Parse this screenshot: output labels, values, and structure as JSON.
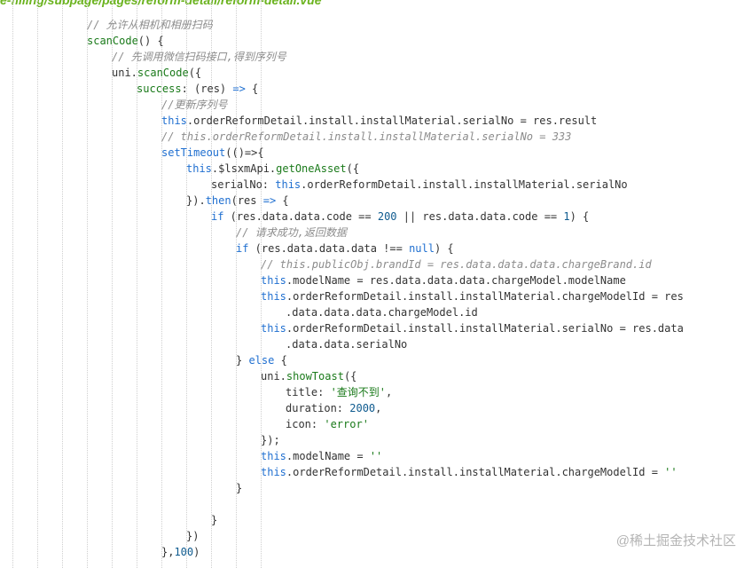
{
  "file_path": "e-filling/subpage/pages/reform-detail/reform-detail.vue",
  "watermark": "@稀土掘金技术社区",
  "colors": {
    "comment": "#8c8c8c",
    "keyword": "#1f6fd0",
    "function": "#1a7a1a",
    "number": "#0f5b8f",
    "string": "#1a7a1a",
    "plain": "#333333",
    "path": "#6bb31f"
  },
  "code_lines": [
    {
      "indent": 3,
      "tokens": [
        {
          "t": "// 允许从相机和相册扫码",
          "c": "cm"
        }
      ]
    },
    {
      "indent": 3,
      "tokens": [
        {
          "t": "scanCode",
          "c": "fn"
        },
        {
          "t": "() {",
          "c": "plain"
        }
      ]
    },
    {
      "indent": 4,
      "tokens": [
        {
          "t": "// 先调用微信扫码接口,得到序列号",
          "c": "cm"
        }
      ]
    },
    {
      "indent": 4,
      "tokens": [
        {
          "t": "uni.",
          "c": "plain"
        },
        {
          "t": "scanCode",
          "c": "fn"
        },
        {
          "t": "({",
          "c": "plain"
        }
      ]
    },
    {
      "indent": 5,
      "tokens": [
        {
          "t": "success",
          "c": "fn"
        },
        {
          "t": ": (res) ",
          "c": "plain"
        },
        {
          "t": "=>",
          "c": "kw"
        },
        {
          "t": " {",
          "c": "plain"
        }
      ]
    },
    {
      "indent": 6,
      "tokens": [
        {
          "t": "//更新序列号",
          "c": "cm"
        }
      ]
    },
    {
      "indent": 6,
      "tokens": [
        {
          "t": "this",
          "c": "kw"
        },
        {
          "t": ".orderReformDetail.install.installMaterial.serialNo = res.result",
          "c": "plain"
        }
      ]
    },
    {
      "indent": 6,
      "tokens": [
        {
          "t": "// this.orderReformDetail.install.installMaterial.serialNo = 333",
          "c": "cm"
        }
      ]
    },
    {
      "indent": 6,
      "tokens": [
        {
          "t": "setTimeout",
          "c": "kw"
        },
        {
          "t": "(()=>{",
          "c": "plain"
        }
      ]
    },
    {
      "indent": 7,
      "tokens": [
        {
          "t": "this",
          "c": "kw"
        },
        {
          "t": ".$lsxmApi.",
          "c": "plain"
        },
        {
          "t": "getOneAsset",
          "c": "fn"
        },
        {
          "t": "({",
          "c": "plain"
        }
      ]
    },
    {
      "indent": 8,
      "tokens": [
        {
          "t": "serialNo: ",
          "c": "plain"
        },
        {
          "t": "this",
          "c": "kw"
        },
        {
          "t": ".orderReformDetail.install.installMaterial.serialNo",
          "c": "plain"
        }
      ]
    },
    {
      "indent": 7,
      "tokens": [
        {
          "t": "}).",
          "c": "plain"
        },
        {
          "t": "then",
          "c": "kw"
        },
        {
          "t": "(res ",
          "c": "plain"
        },
        {
          "t": "=>",
          "c": "kw"
        },
        {
          "t": " {",
          "c": "plain"
        }
      ]
    },
    {
      "indent": 8,
      "tokens": [
        {
          "t": "if",
          "c": "kw"
        },
        {
          "t": " (res.data.data.code == ",
          "c": "plain"
        },
        {
          "t": "200",
          "c": "num"
        },
        {
          "t": " || res.data.data.code == ",
          "c": "plain"
        },
        {
          "t": "1",
          "c": "num"
        },
        {
          "t": ") {",
          "c": "plain"
        }
      ]
    },
    {
      "indent": 9,
      "tokens": [
        {
          "t": "// 请求成功,返回数据",
          "c": "cm"
        }
      ]
    },
    {
      "indent": 9,
      "tokens": [
        {
          "t": "if",
          "c": "kw"
        },
        {
          "t": " (res.data.data.data !== ",
          "c": "plain"
        },
        {
          "t": "null",
          "c": "kw"
        },
        {
          "t": ") {",
          "c": "plain"
        }
      ]
    },
    {
      "indent": 10,
      "tokens": [
        {
          "t": "// this.publicObj.brandId = res.data.data.data.chargeBrand.id",
          "c": "cm"
        }
      ]
    },
    {
      "indent": 10,
      "tokens": [
        {
          "t": "this",
          "c": "kw"
        },
        {
          "t": ".modelName = res.data.data.data.chargeModel.modelName",
          "c": "plain"
        }
      ]
    },
    {
      "indent": 10,
      "tokens": [
        {
          "t": "this",
          "c": "kw"
        },
        {
          "t": ".orderReformDetail.install.installMaterial.chargeModelId = res",
          "c": "plain"
        }
      ]
    },
    {
      "indent": 11,
      "tokens": [
        {
          "t": ".data.data.data.chargeModel.id",
          "c": "plain"
        }
      ]
    },
    {
      "indent": 10,
      "tokens": [
        {
          "t": "this",
          "c": "kw"
        },
        {
          "t": ".orderReformDetail.install.installMaterial.serialNo = res.data",
          "c": "plain"
        }
      ]
    },
    {
      "indent": 11,
      "tokens": [
        {
          "t": ".data.data.serialNo",
          "c": "plain"
        }
      ]
    },
    {
      "indent": 9,
      "tokens": [
        {
          "t": "} ",
          "c": "plain"
        },
        {
          "t": "else",
          "c": "kw"
        },
        {
          "t": " {",
          "c": "plain"
        }
      ]
    },
    {
      "indent": 10,
      "tokens": [
        {
          "t": "uni.",
          "c": "plain"
        },
        {
          "t": "showToast",
          "c": "fn"
        },
        {
          "t": "({",
          "c": "plain"
        }
      ]
    },
    {
      "indent": 11,
      "tokens": [
        {
          "t": "title: ",
          "c": "plain"
        },
        {
          "t": "'查询不到'",
          "c": "str"
        },
        {
          "t": ",",
          "c": "plain"
        }
      ]
    },
    {
      "indent": 11,
      "tokens": [
        {
          "t": "duration: ",
          "c": "plain"
        },
        {
          "t": "2000",
          "c": "num"
        },
        {
          "t": ",",
          "c": "plain"
        }
      ]
    },
    {
      "indent": 11,
      "tokens": [
        {
          "t": "icon: ",
          "c": "plain"
        },
        {
          "t": "'error'",
          "c": "str"
        }
      ]
    },
    {
      "indent": 10,
      "tokens": [
        {
          "t": "});",
          "c": "plain"
        }
      ]
    },
    {
      "indent": 10,
      "tokens": [
        {
          "t": "this",
          "c": "kw"
        },
        {
          "t": ".modelName = ",
          "c": "plain"
        },
        {
          "t": "''",
          "c": "str"
        }
      ]
    },
    {
      "indent": 10,
      "tokens": [
        {
          "t": "this",
          "c": "kw"
        },
        {
          "t": ".orderReformDetail.install.installMaterial.chargeModelId = ",
          "c": "plain"
        },
        {
          "t": "''",
          "c": "str"
        }
      ]
    },
    {
      "indent": 9,
      "tokens": [
        {
          "t": "}",
          "c": "plain"
        }
      ]
    },
    {
      "indent": 0,
      "tokens": []
    },
    {
      "indent": 8,
      "tokens": [
        {
          "t": "}",
          "c": "plain"
        }
      ]
    },
    {
      "indent": 7,
      "tokens": [
        {
          "t": "})",
          "c": "plain"
        }
      ]
    },
    {
      "indent": 6,
      "tokens": [
        {
          "t": "},",
          "c": "plain"
        },
        {
          "t": "100",
          "c": "num"
        },
        {
          "t": ")",
          "c": "plain"
        }
      ]
    }
  ]
}
